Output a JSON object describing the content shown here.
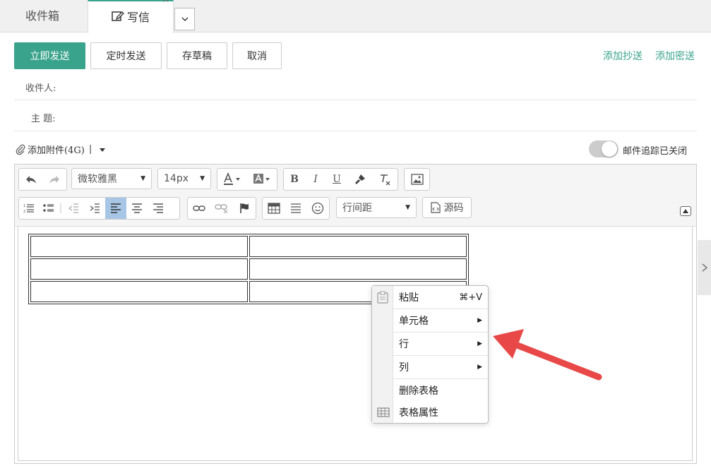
{
  "tabs": {
    "inbox": "收件箱",
    "compose": "写信",
    "close": "×"
  },
  "toolbar": {
    "send_now": "立即发送",
    "scheduled_send": "定时发送",
    "save_draft": "存草稿",
    "cancel": "取消",
    "add_cc": "添加抄送",
    "add_bcc": "添加密送"
  },
  "fields": {
    "recipient_label": "收件人:",
    "subject_label": "主 题:"
  },
  "attachment": {
    "label": "添加附件(4G)",
    "separator": "|"
  },
  "tracking": {
    "label": "邮件追踪已关闭",
    "enabled": false
  },
  "editor": {
    "font_family": "微软雅黑",
    "font_size": "14px",
    "line_height_label": "行间距",
    "source_label": "源码",
    "table": {
      "rows": 3,
      "cols": 2
    }
  },
  "context_menu": {
    "items": [
      {
        "label": "粘贴",
        "shortcut": "⌘+V",
        "submenu": false,
        "icon": "clipboard-icon"
      },
      {
        "label": "单元格",
        "submenu": true
      },
      {
        "label": "行",
        "submenu": true
      },
      {
        "label": "列",
        "submenu": true
      },
      {
        "label": "删除表格",
        "submenu": false
      },
      {
        "label": "表格属性",
        "submenu": false,
        "icon": "table-icon"
      }
    ]
  },
  "colors": {
    "accent": "#3aa38c",
    "arrow": "#e84848",
    "active_button": "#a7c6e6"
  }
}
